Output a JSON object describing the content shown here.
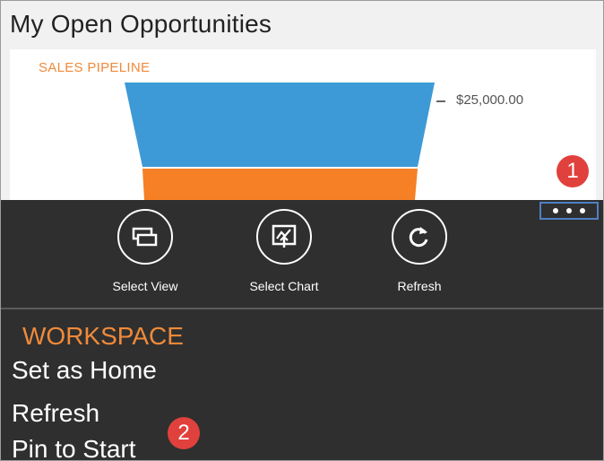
{
  "page": {
    "title": "My Open Opportunities"
  },
  "chart_data": {
    "type": "funnel",
    "title": "SALES PIPELINE",
    "tick_labels": [
      "$25,000.00"
    ],
    "colors": {
      "stage1": "#3d9ad6",
      "stage2": "#f58025"
    }
  },
  "appbar": {
    "more_label": "...",
    "commands": [
      {
        "label": "Select View",
        "icon": "select-view-icon"
      },
      {
        "label": "Select Chart",
        "icon": "select-chart-icon"
      },
      {
        "label": "Refresh",
        "icon": "refresh-icon"
      }
    ]
  },
  "menu": {
    "heading": "WORKSPACE",
    "items": [
      "Set as Home",
      "Refresh",
      "Pin to Start"
    ]
  },
  "badges": [
    "1",
    "2"
  ],
  "colors": {
    "accent": "#f08a3a",
    "appbar": "#2f2f2f",
    "badge": "#e0413c",
    "highlight": "#4f80c4"
  }
}
